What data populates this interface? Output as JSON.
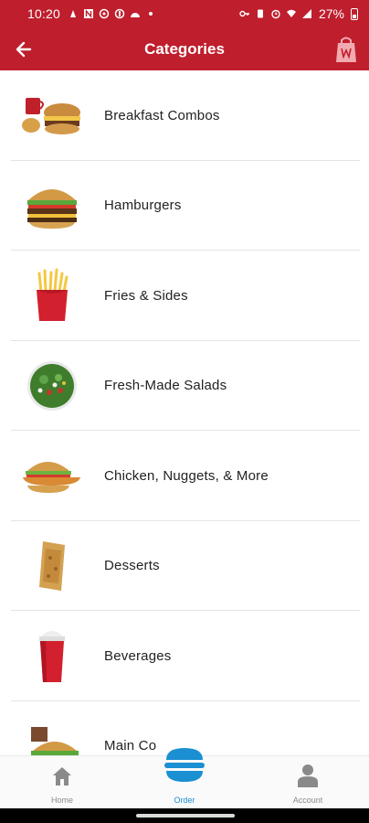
{
  "status_bar": {
    "time": "10:20",
    "battery": "27%"
  },
  "app_bar": {
    "title": "Categories",
    "back_icon": "back-arrow-icon",
    "bag_icon": "shopping-bag-icon"
  },
  "categories": [
    {
      "label": "Breakfast Combos",
      "icon": "breakfast-combo-image"
    },
    {
      "label": "Hamburgers",
      "icon": "hamburger-image"
    },
    {
      "label": "Fries & Sides",
      "icon": "fries-image"
    },
    {
      "label": "Fresh-Made Salads",
      "icon": "salad-image"
    },
    {
      "label": "Chicken, Nuggets, & More",
      "icon": "chicken-sandwich-image"
    },
    {
      "label": "Desserts",
      "icon": "dessert-pie-image"
    },
    {
      "label": "Beverages",
      "icon": "beverage-cup-image"
    },
    {
      "label": "Main Co",
      "icon": "main-combo-image"
    }
  ],
  "bottom_nav": {
    "home": "Home",
    "order": "Order",
    "account": "Account"
  },
  "colors": {
    "brand_red": "#bf1e2d",
    "order_blue": "#1a8fd1"
  }
}
